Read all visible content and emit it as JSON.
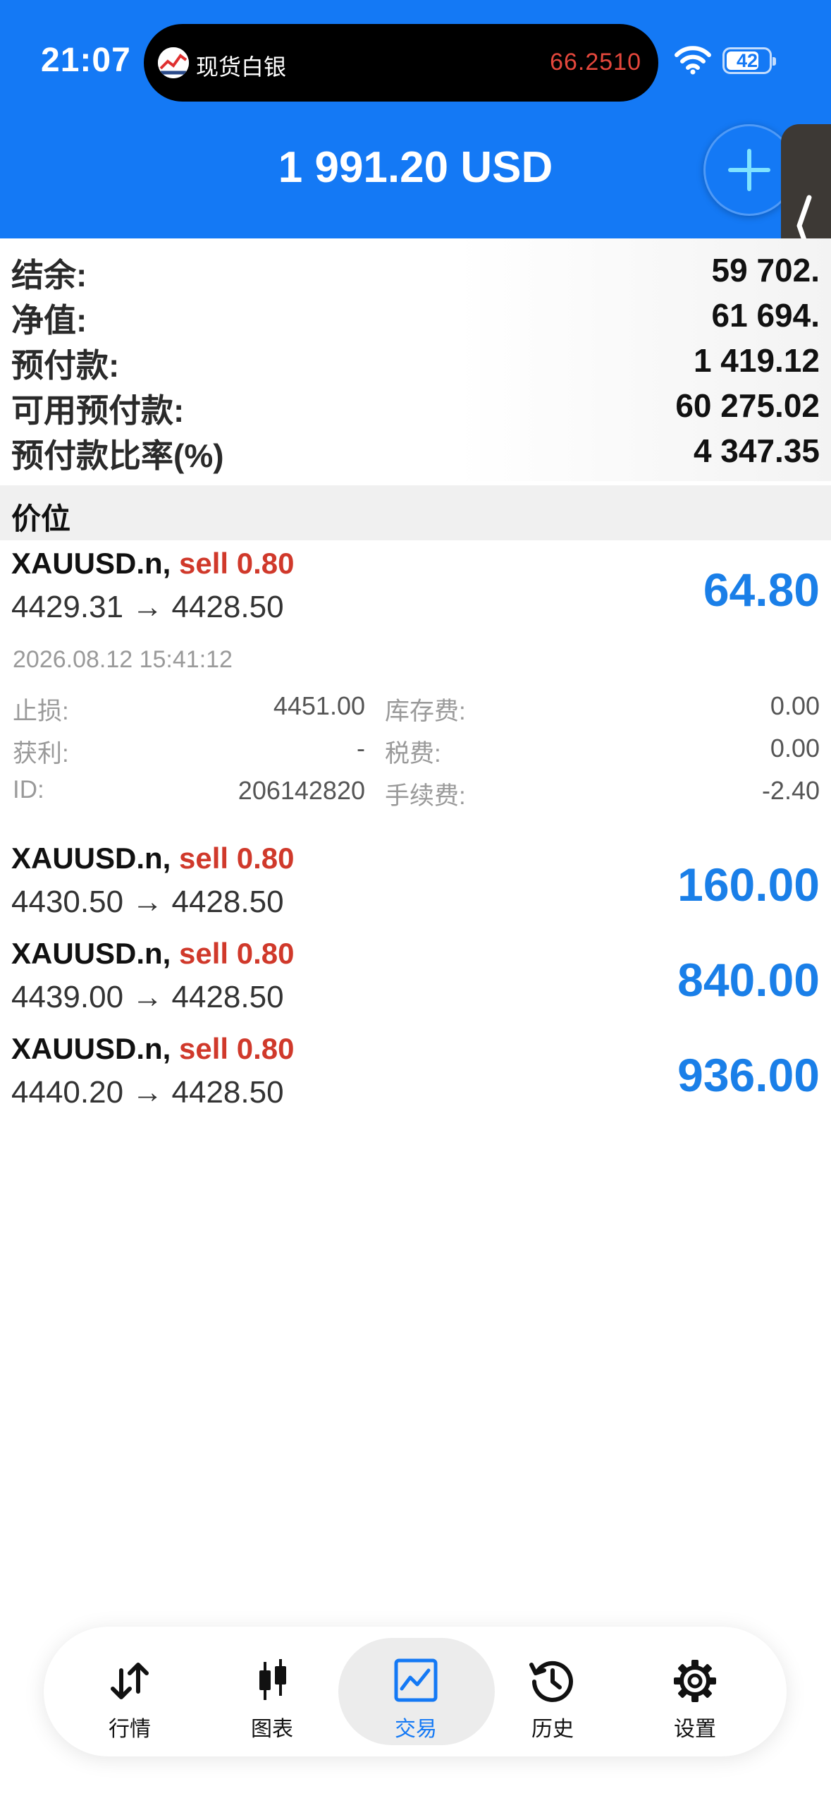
{
  "status_bar": {
    "time": "21:07",
    "island_app": "现货白银",
    "island_price": "66.2510",
    "battery": "42"
  },
  "header": {
    "balance_title": "1 991.20 USD"
  },
  "account": [
    {
      "label": "结余:",
      "value": "59 702."
    },
    {
      "label": "净值:",
      "value": "61 694."
    },
    {
      "label": "预付款:",
      "value": "1 419.12"
    },
    {
      "label": "可用预付款:",
      "value": "60 275.02"
    },
    {
      "label": "预付款比率(%)",
      "value": "4 347.35"
    }
  ],
  "section_title": "价位",
  "positions": [
    {
      "symbol": "XAUUSD.n,",
      "side": "sell 0.80",
      "prices": "4429.31 → 4428.50",
      "profit": "64.80"
    },
    {
      "symbol": "XAUUSD.n,",
      "side": "sell 0.80",
      "prices": "4430.50 → 4428.50",
      "profit": "160.00"
    },
    {
      "symbol": "XAUUSD.n,",
      "side": "sell 0.80",
      "prices": "4439.00 → 4428.50",
      "profit": "840.00"
    },
    {
      "symbol": "XAUUSD.n,",
      "side": "sell 0.80",
      "prices": "4440.20 → 4428.50",
      "profit": "936.00"
    }
  ],
  "detail": {
    "time": "2026.08.12 15:41:12",
    "stop_loss_label": "止损:",
    "stop_loss": "4451.00",
    "take_profit_label": "获利:",
    "take_profit": "-",
    "id_label": "ID:",
    "id": "206142820",
    "swap_label": "库存费:",
    "swap": "0.00",
    "tax_label": "税费:",
    "tax": "0.00",
    "commission_label": "手续费:",
    "commission": "-2.40"
  },
  "nav": [
    {
      "label": "行情",
      "icon": "quotes-arrows-icon"
    },
    {
      "label": "图表",
      "icon": "candlestick-icon"
    },
    {
      "label": "交易",
      "icon": "trade-chart-icon"
    },
    {
      "label": "历史",
      "icon": "history-clock-icon"
    },
    {
      "label": "设置",
      "icon": "gear-icon"
    }
  ],
  "colors": {
    "brand_blue": "#1479f5",
    "profit_blue": "#1a7fe8",
    "sell_red": "#d0392b"
  }
}
